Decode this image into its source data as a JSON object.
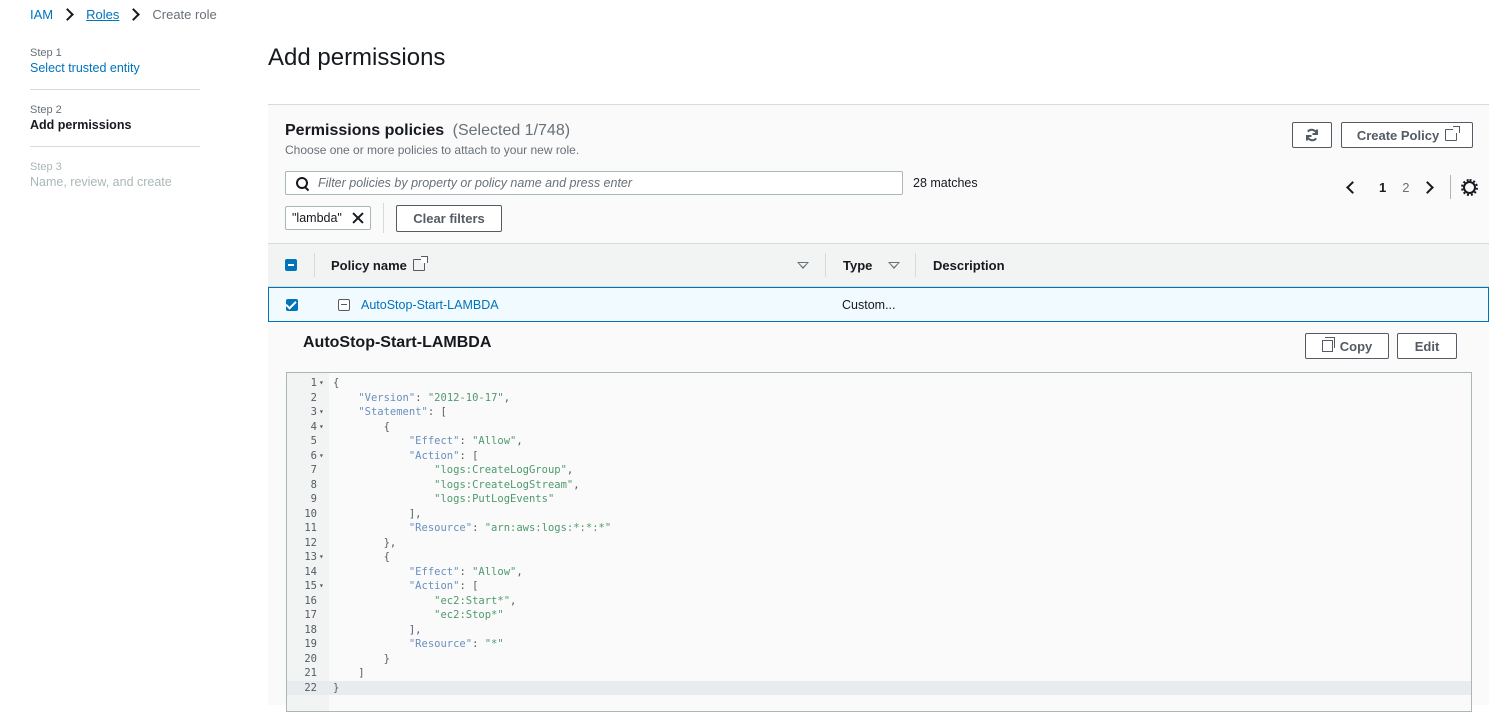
{
  "breadcrumb": {
    "root": "IAM",
    "roles": "Roles",
    "current": "Create role"
  },
  "steps": [
    {
      "num": "Step 1",
      "title": "Select trusted entity"
    },
    {
      "num": "Step 2",
      "title": "Add permissions"
    },
    {
      "num": "Step 3",
      "title": "Name, review, and create"
    }
  ],
  "page_title": "Add permissions",
  "panel": {
    "title": "Permissions policies",
    "selected": "(Selected 1/748)",
    "description": "Choose one or more policies to attach to your new role.",
    "create_policy": "Create Policy",
    "search_placeholder": "Filter policies by property or policy name and press enter",
    "matches": "28 matches",
    "pages": [
      "1",
      "2"
    ],
    "filter_token": "\"lambda\"",
    "clear_filters": "Clear filters"
  },
  "table": {
    "columns": {
      "policy_name": "Policy name",
      "type": "Type",
      "description": "Description"
    },
    "rows": [
      {
        "name": "AutoStop-Start-LAMBDA",
        "type": "Custom...",
        "description": ""
      }
    ]
  },
  "detail": {
    "title": "AutoStop-Start-LAMBDA",
    "copy": "Copy",
    "edit": "Edit"
  },
  "code_lines": [
    "{",
    "    \"Version\": \"2012-10-17\",",
    "    \"Statement\": [",
    "        {",
    "            \"Effect\": \"Allow\",",
    "            \"Action\": [",
    "                \"logs:CreateLogGroup\",",
    "                \"logs:CreateLogStream\",",
    "                \"logs:PutLogEvents\"",
    "            ],",
    "            \"Resource\": \"arn:aws:logs:*:*:*\"",
    "        },",
    "        {",
    "            \"Effect\": \"Allow\",",
    "            \"Action\": [",
    "                \"ec2:Start*\",",
    "                \"ec2:Stop*\"",
    "            ],",
    "            \"Resource\": \"*\"",
    "        }",
    "    ]",
    "}"
  ],
  "fold_lines": [
    1,
    3,
    4,
    6,
    13,
    15
  ],
  "colors": {
    "accent": "#0073bb",
    "selected_row_bg": "#f1faff"
  },
  "icons": [
    "chevron-right-icon",
    "refresh-icon",
    "external-link-icon",
    "search-icon",
    "chevron-left-icon",
    "gear-icon",
    "close-icon",
    "checkbox-icon",
    "collapse-icon",
    "copy-icon"
  ]
}
